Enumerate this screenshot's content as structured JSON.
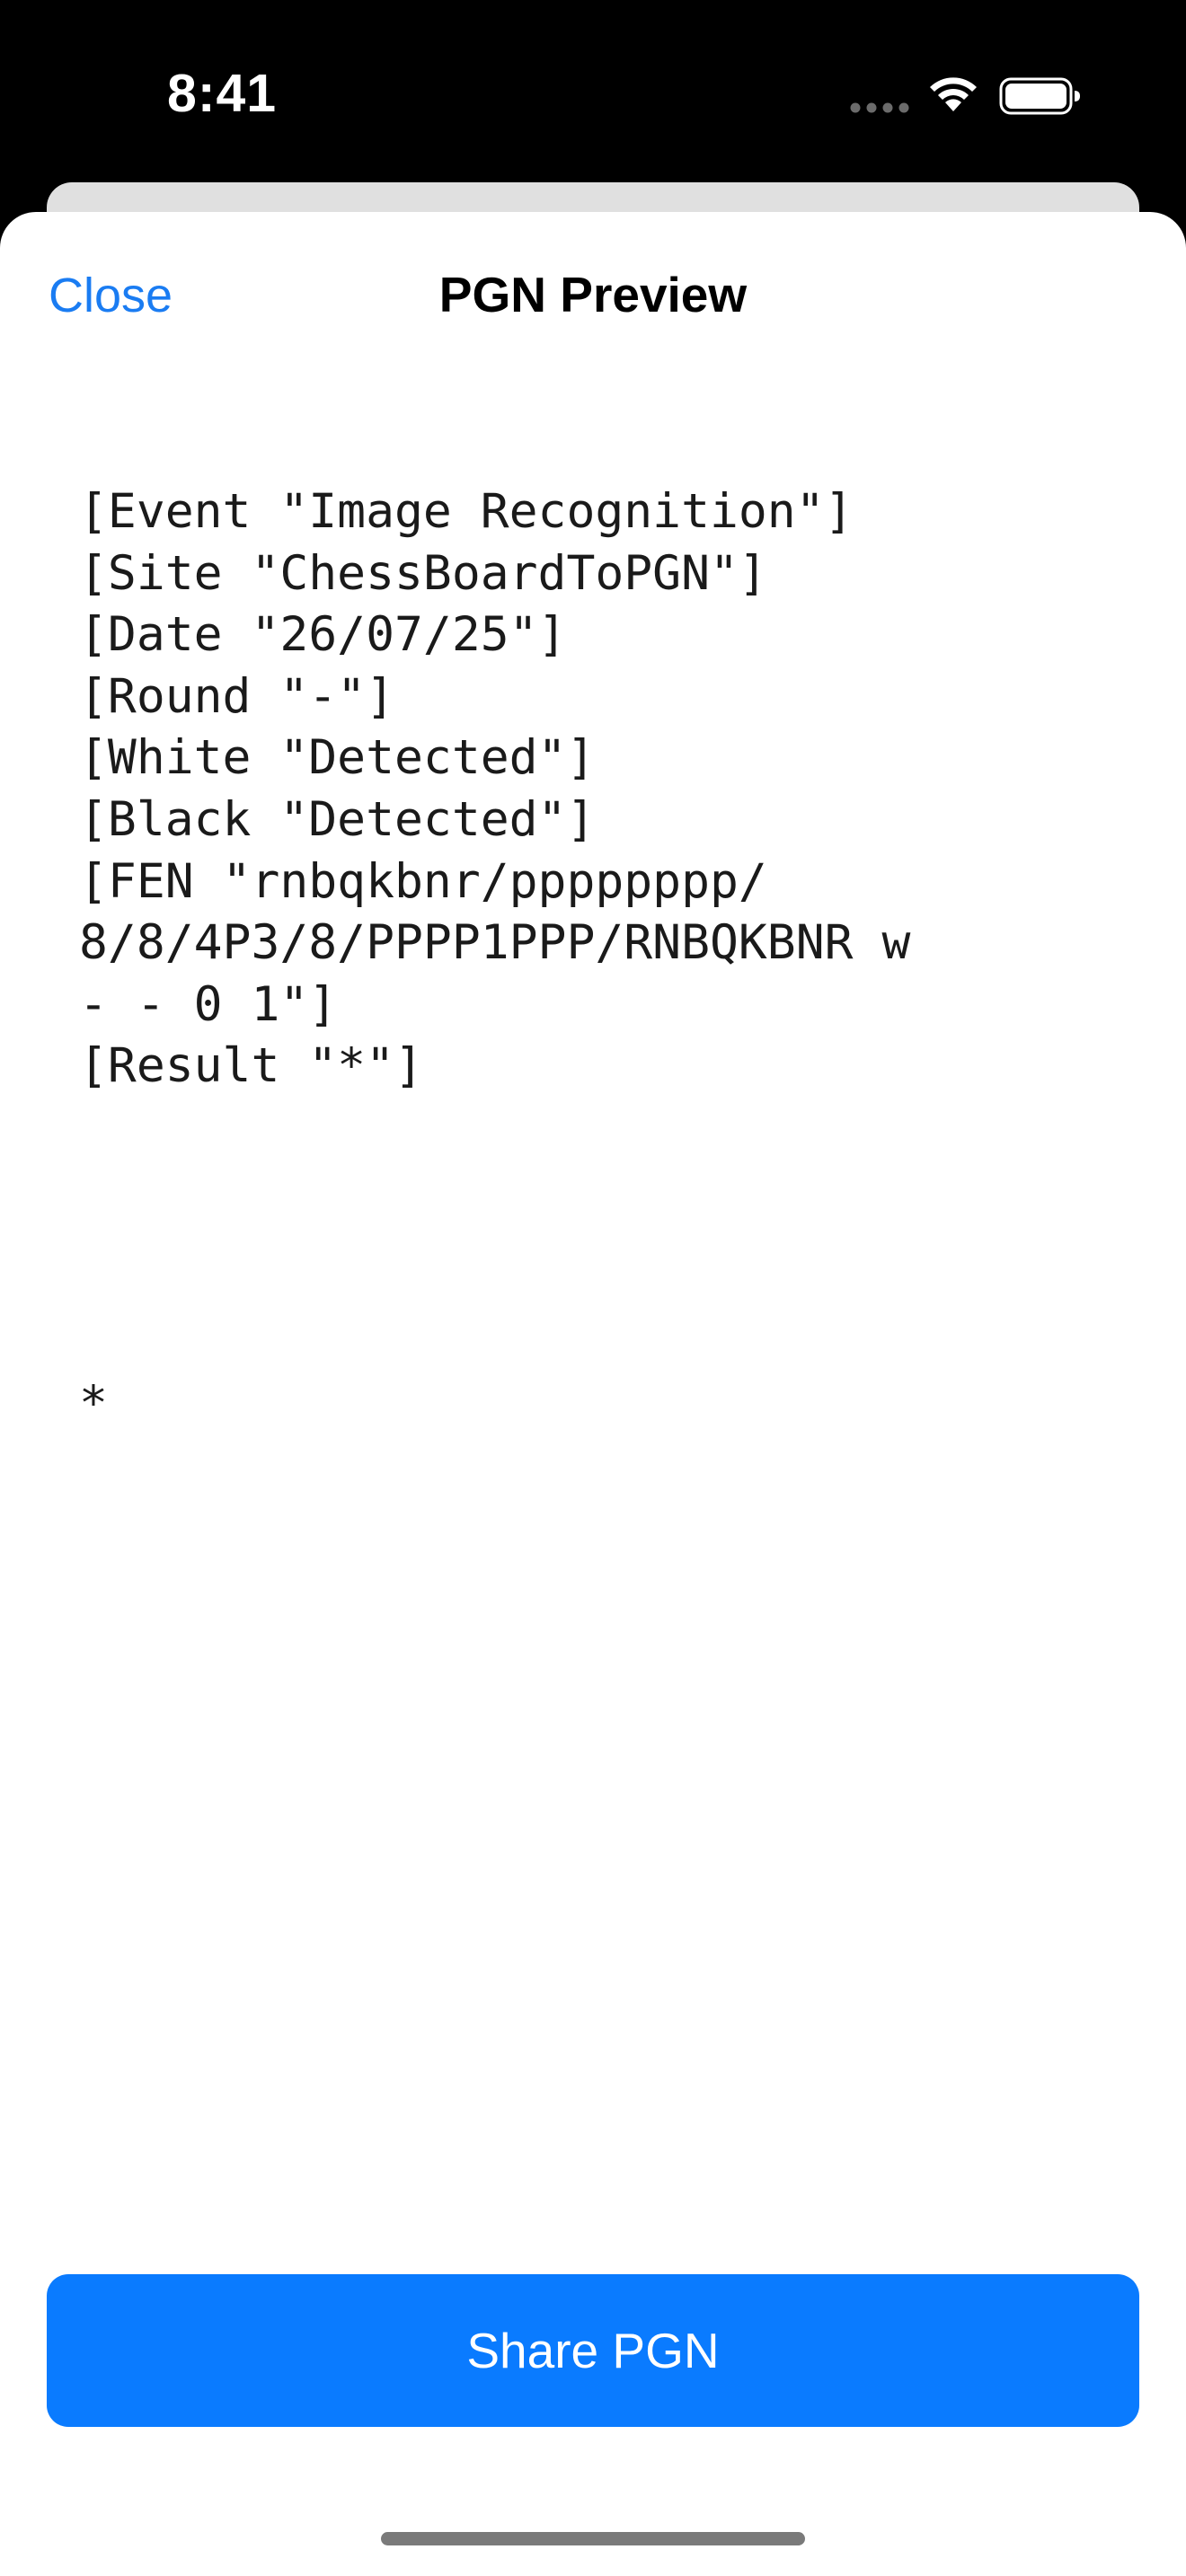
{
  "status_bar": {
    "time": "8:41",
    "icons": [
      "signal-dots-icon",
      "wifi-icon",
      "battery-icon"
    ]
  },
  "nav": {
    "close_label": "Close",
    "title": "PGN Preview"
  },
  "pgn": {
    "lines": [
      "[Event \"Image Recognition\"]",
      "[Site \"ChessBoardToPGN\"]",
      "[Date \"26/07/25\"]",
      "[Round \"-\"]",
      "[White \"Detected\"]",
      "[Black \"Detected\"]",
      "[FEN \"rnbqkbnr/pppppppp/",
      "8/8/4P3/8/PPPP1PPP/RNBQKBNR w",
      "- - 0 1\"]",
      "[Result \"*\"]"
    ],
    "result": "*"
  },
  "actions": {
    "share_label": "Share PGN"
  },
  "colors": {
    "accent": "#0a7bff",
    "link": "#1a7cf2",
    "background": "#ffffff",
    "status_bar_bg": "#000000"
  }
}
